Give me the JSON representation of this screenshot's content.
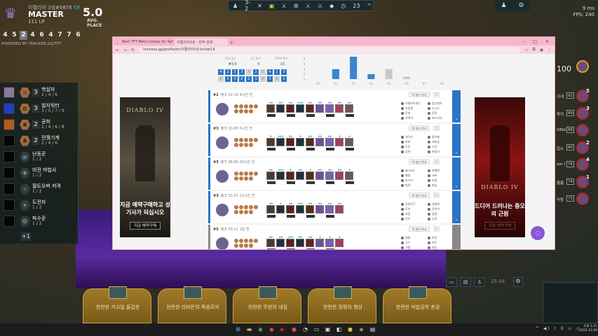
{
  "profile": {
    "summoner": "이렐리아 3성",
    "tag": "#9876",
    "region": "KR",
    "tier": "MASTER",
    "lp": "111 LP",
    "avg_place": "5.0",
    "avg_label": "AVG. PLACE",
    "recent": [
      "4",
      "5",
      "2",
      "4",
      "6",
      "4",
      "7",
      "7",
      "6"
    ],
    "selected_index": 2,
    "powered": "POWERED BY TRACKER.GG/TFT"
  },
  "traits": [
    {
      "count": "3",
      "name": "학살자",
      "tiers": "2 / 4 / 6",
      "active": true,
      "icon": "⚔"
    },
    {
      "count": "3",
      "name": "빌지워터",
      "tiers": "3 / 5 / 7 / 9",
      "active": true,
      "icon": "✿"
    },
    {
      "count": "2",
      "name": "공허",
      "tiers": "2 / 4 / 6 / 8",
      "active": true,
      "icon": "✺"
    },
    {
      "count": "2",
      "name": "전쟁기계",
      "tiers": "2 / 4 / 6",
      "active": true,
      "icon": "♣"
    },
    {
      "count": "",
      "name": "난동꾼",
      "tiers": "1 / 2",
      "active": false,
      "icon": "⊞"
    },
    {
      "count": "",
      "name": "비전 마법사",
      "tiers": "1 / 2",
      "active": false,
      "icon": "❋"
    },
    {
      "count": "",
      "name": "필트오버 저격",
      "tiers": "1 / 2",
      "active": false,
      "icon": "✧"
    },
    {
      "count": "",
      "name": "도전자",
      "tiers": "1 / 2",
      "active": false,
      "icon": "✶"
    },
    {
      "count": "",
      "name": "파수꾼",
      "tiers": "1 / 2",
      "active": false,
      "icon": "❂"
    }
  ],
  "traits_more": "+1",
  "hud": {
    "stage": "3-2",
    "gold": "23",
    "ping": "9 ms",
    "fps": "FPS: 240",
    "timer": "25:34"
  },
  "browser": {
    "tabs": [
      "Best TFT Meta Comps for Set",
      "이렐리아3성 - 전적 검색"
    ],
    "url": "lolchess.gg/profile/kr/이렐리아3성-kr/set14"
  },
  "stats": {
    "labels": [
      "평균 등수",
      "1등 횟수",
      "TOP4 횟수"
    ],
    "values": [
      "#3.5",
      "0",
      "15"
    ],
    "recent": [
      "4",
      "2",
      "3",
      "3",
      "5",
      "2",
      "5",
      "4",
      "2",
      "3",
      "5",
      "3",
      "3",
      "2",
      "2",
      "3",
      "5",
      "3",
      "5",
      "2"
    ]
  },
  "chart_data": {
    "type": "bar",
    "categories": [
      "#1",
      "#2",
      "#3",
      "#4",
      "#5",
      "#6",
      "#7",
      "#8"
    ],
    "values": [
      0,
      4,
      9,
      2,
      4,
      1,
      0,
      0
    ],
    "ylim": [
      0,
      9
    ],
    "yticks": [
      0,
      2,
      4,
      6,
      8
    ],
    "colors": {
      "top4": "#3a86cf",
      "bottom4": "#c8c8cc"
    }
  },
  "matches": [
    {
      "place": "#2",
      "meta": "랭크 32:10 4시간 전",
      "stars": [
        2,
        2,
        2,
        3,
        2,
        2,
        2,
        2,
        2
      ],
      "players": [
        "이렐리아3성",
        "탑신병자",
        "상점왕",
        "노시드",
        "토끼",
        "루팡",
        "전략가",
        "버스기사"
      ]
    },
    {
      "place": "#3",
      "meta": "랭크 33:05 5시간 전",
      "stars": [
        1,
        3,
        2,
        1,
        2,
        2,
        2,
        1,
        1
      ],
      "players": [
        "개구리",
        "밤하늘",
        "초보",
        "헤비급",
        "도전",
        "시간",
        "공략",
        "마법사"
      ]
    },
    {
      "place": "#3",
      "meta": "랭크 36:06 20시간 전",
      "stars": [
        2,
        3,
        1,
        2,
        1,
        2,
        2,
        2,
        1
      ],
      "players": [
        "winner",
        "연패왕",
        "별빛",
        "rwd",
        "마스터",
        "조합",
        "방랑",
        "형님"
      ]
    },
    {
      "place": "#3",
      "meta": "랭크 33:32 21시간 전",
      "stars": [
        2,
        1,
        2,
        3,
        2,
        2,
        2,
        2
      ],
      "players": [
        "강한친구",
        "연패왕",
        "토끼",
        "전략가",
        "요정",
        "곰탱",
        "선수",
        "무적"
      ]
    },
    {
      "place": "#5",
      "meta": "랭크 33:11 1일 전",
      "stars": [
        2,
        2,
        3,
        2,
        2,
        1,
        1,
        1
      ],
      "players": [
        "평범",
        "하루",
        "고수",
        "여우",
        "구름",
        "연승",
        "바람",
        "달빛"
      ]
    }
  ],
  "match_btn": "덱 빌더 복사",
  "ads": {
    "left": {
      "logo": "DIABLO IV",
      "copy": "지금 예약구매하고 성기사가 되십시오",
      "cta": "지금 예약구매"
    },
    "right": {
      "logo": "DIABLO IV",
      "copy": "드디어 드러나는 증오의 근원",
      "cta": "지금 예약구매"
    }
  },
  "lobby": [
    {
      "name": "가게",
      "hp": "100",
      "badge": ""
    },
    {
      "name": "가게",
      "hp": "92",
      "badge": "5"
    },
    {
      "name": "왁이",
      "hp": "89",
      "badge": "3"
    },
    {
      "name": "SING",
      "hp": "88",
      "badge": ""
    },
    {
      "name": "집소",
      "hp": "80",
      "badge": "2"
    },
    {
      "name": "am I",
      "hp": "76",
      "badge": "4"
    },
    {
      "name": "클롭",
      "hp": "74",
      "badge": "1"
    },
    {
      "name": "사람",
      "hp": "71",
      "badge": ""
    }
  ],
  "shop": [
    "찬란한 거고일 돌갑옷",
    "찬란한 라바돈의 죽음모자",
    "찬란한 무한의 대검",
    "찬란한 정령의 형상",
    "찬란한 마법공학 총검"
  ],
  "clock": {
    "time": "오후 1:21",
    "date": "2025-12-26"
  }
}
